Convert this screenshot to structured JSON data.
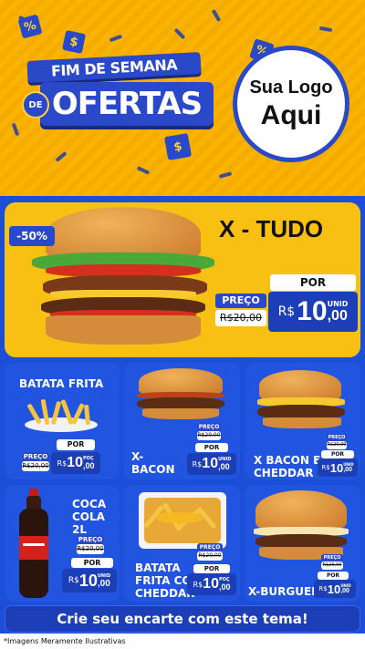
{
  "header": {
    "headline_top": "FIM DE SEMANA",
    "headline_de": "DE",
    "headline_main": "OFERTAS",
    "logo_line1": "Sua Logo",
    "logo_line2": "Aqui",
    "confetti_symbols": [
      "%",
      "$",
      "%",
      "$"
    ]
  },
  "hero": {
    "discount": "-50%",
    "title": "X - TUDO",
    "preco_label": "PREÇO",
    "old_price": "R$20,00",
    "por_label": "POR",
    "currency": "R$",
    "new_int": "10",
    "new_dec": ",00",
    "unid": "UNID"
  },
  "products": [
    {
      "name": "BATATA FRITA",
      "preco_label": "PREÇO",
      "old_price": "R$20,00",
      "por_label": "POR",
      "currency": "R$",
      "new_int": "10",
      "new_dec": ",00",
      "unid": "POÇ"
    },
    {
      "name": "X-\nBACON",
      "name_l1": "X-",
      "name_l2": "BACON",
      "preco_label": "PREÇO",
      "old_price": "R$20,00",
      "por_label": "POR",
      "currency": "R$",
      "new_int": "10",
      "new_dec": ",00",
      "unid": "UNID"
    },
    {
      "name": "X BACON E CHEDDAR",
      "name_l1": "X BACON E",
      "name_l2": "CHEDDAR",
      "preco_label": "PREÇO",
      "old_price": "R$20,00",
      "por_label": "POR",
      "currency": "R$",
      "new_int": "10",
      "new_dec": ",00",
      "unid": "UNID"
    },
    {
      "name": "COCA COLA 2L",
      "name_l1": "COCA",
      "name_l2": "COLA 2L",
      "preco_label": "PREÇO",
      "old_price": "R$20,00",
      "por_label": "POR",
      "currency": "R$",
      "new_int": "10",
      "new_dec": ",00",
      "unid": "UNID"
    },
    {
      "name": "BATATA FRITA COM CHEDDAR",
      "name_l1": "BATATA",
      "name_l2": "FRITA COM",
      "name_l3": "CHEDDAR",
      "preco_label": "PREÇO",
      "old_price": "R$20,00",
      "por_label": "POR",
      "currency": "R$",
      "new_int": "10",
      "new_dec": ",00",
      "unid": "POÇ"
    },
    {
      "name": "X-BURGUER",
      "preco_label": "PREÇO",
      "old_price": "R$20,00",
      "por_label": "POR",
      "currency": "R$",
      "new_int": "10",
      "new_dec": ",00",
      "unid": "UNID"
    }
  ],
  "cta": "Crie seu encarte com este tema!",
  "footnote": "*Imagens Meramente Ilustrativas",
  "colors": {
    "accent_blue": "#1c4ed8",
    "yellow": "#f8c012",
    "dark_blue": "#1c3fb8"
  }
}
